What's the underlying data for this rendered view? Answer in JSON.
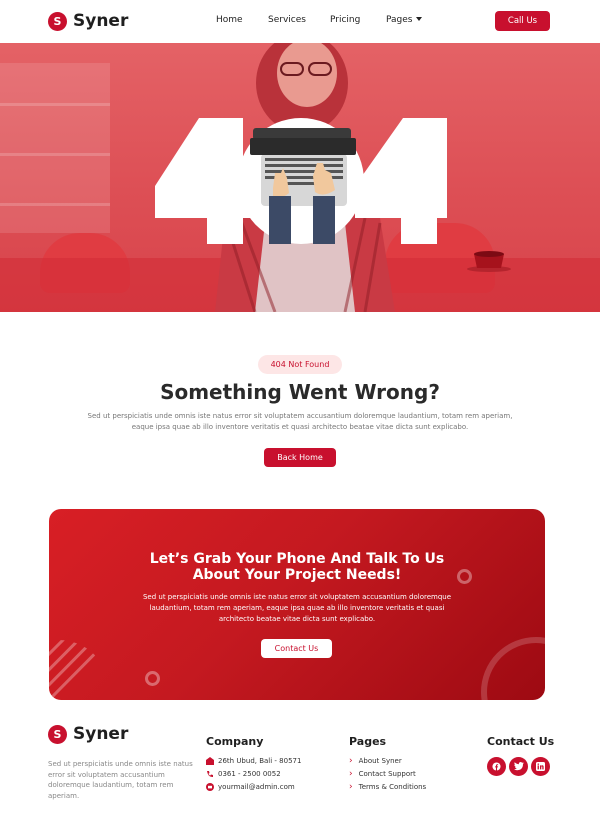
{
  "brand": {
    "name": "Syner",
    "mark": "S"
  },
  "nav": {
    "items": [
      "Home",
      "Services",
      "Pricing",
      "Pages"
    ],
    "cta_label": "Call Us"
  },
  "hero": {
    "code": "404"
  },
  "error": {
    "badge": "404 Not Found",
    "title": "Something Went Wrong?",
    "description": "Sed ut perspiciatis unde omnis iste natus error sit voluptatem accusantium doloremque laudantium, totam rem aperiam, eaque ipsa quae ab illo inventore veritatis et quasi architecto beatae vitae dicta sunt explicabo.",
    "button": "Back Home"
  },
  "cta": {
    "title_line1": "Let’s Grab Your Phone And Talk To Us",
    "title_line2": "About Your Project Needs!",
    "description": "Sed ut perspiciatis unde omnis iste natus error sit voluptatem accusantium doloremque laudantium, totam rem aperiam, eaque ipsa quae ab illo inventore veritatis et quasi architecto beatae vitae dicta sunt explicabo.",
    "button": "Contact Us"
  },
  "footer": {
    "description": "Sed ut perspiciatis unde omnis iste natus error sit voluptatem accusantium doloremque laudantium, totam rem aperiam.",
    "company": {
      "heading": "Company",
      "address": "26th Ubud, Bali - 80571",
      "phone": "0361 - 2500 0052",
      "email": "yourmail@admin.com"
    },
    "pages": {
      "heading": "Pages",
      "links": [
        "About Syner",
        "Contact Support",
        "Terms & Conditions"
      ]
    },
    "contact": {
      "heading": "Contact Us",
      "socials": [
        "facebook-icon",
        "twitter-icon",
        "linkedin-icon"
      ]
    }
  },
  "colors": {
    "accent": "#c8102e",
    "dark": "#1f1f1f",
    "muted": "#777777"
  }
}
